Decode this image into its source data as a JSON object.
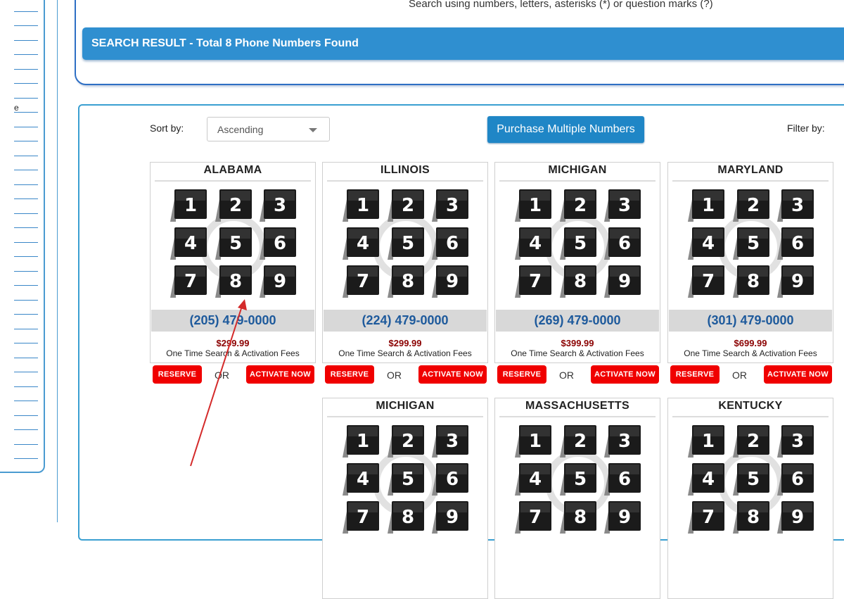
{
  "sidebar": {
    "fragment": "e"
  },
  "search": {
    "hint": "Search using numbers, letters, asterisks (*) or question marks (?)"
  },
  "result": {
    "title": "SEARCH RESULT -",
    "subtitle": "Total 8 Phone Numbers Found"
  },
  "controls": {
    "sort_label": "Sort by:",
    "sort_value": "Ascending",
    "purchase_label": "Purchase Multiple Numbers",
    "filter_label": "Filter by:"
  },
  "keypad_digits": [
    "1",
    "2",
    "3",
    "4",
    "5",
    "6",
    "7",
    "8",
    "9"
  ],
  "actions": {
    "reserve": "RESERVE",
    "or": "OR",
    "activate": "ACTIVATE NOW"
  },
  "listings": [
    {
      "state": "ALABAMA",
      "phone": "(205) 479-0000",
      "price": "$299.99",
      "fees": "One Time Search & Activation Fees"
    },
    {
      "state": "ILLINOIS",
      "phone": "(224) 479-0000",
      "price": "$299.99",
      "fees": "One Time Search & Activation Fees"
    },
    {
      "state": "MICHIGAN",
      "phone": "(269) 479-0000",
      "price": "$399.99",
      "fees": "One Time Search & Activation Fees"
    },
    {
      "state": "MARYLAND",
      "phone": "(301) 479-0000",
      "price": "$699.99",
      "fees": "One Time Search & Activation Fees"
    },
    {
      "state": "MICHIGAN",
      "phone": "",
      "price": "",
      "fees": ""
    },
    {
      "state": "MASSACHUSETTS",
      "phone": "",
      "price": "",
      "fees": ""
    },
    {
      "state": "KENTUCKY",
      "phone": "",
      "price": "",
      "fees": ""
    }
  ],
  "colors": {
    "accent_blue": "#2f8fd0",
    "button_blue": "#1f86c6",
    "action_red": "#f00000",
    "price_red": "#8b0000",
    "phone_blue": "#1e5a9c",
    "annotation_red": "#d42a2a"
  }
}
